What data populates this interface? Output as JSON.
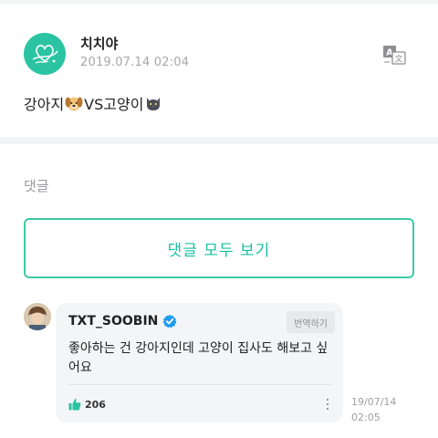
{
  "post": {
    "author": "치치야",
    "date": "2019.07.14 02:04",
    "text_part1": "강아지",
    "text_part2": "VS고양이",
    "emoji_1": "dog-face-icon",
    "emoji_2": "cat-face-icon",
    "translate_icon": "translate-icon"
  },
  "comments": {
    "label": "댓글",
    "view_all_label": "댓글 모두 보기",
    "items": [
      {
        "author": "TXT_SOOBIN",
        "verified": true,
        "translate_label": "번역하기",
        "text": "좋아하는 건 강아지인데 고양이 집사도 해보고 싶어요",
        "likes": "206",
        "time_line1": "19/07/14",
        "time_line2": "02:05"
      }
    ]
  },
  "colors": {
    "accent": "#3ec9a7",
    "accent_text": "#19c0a0",
    "verified": "#1f9cf0",
    "like": "#2bc4a3",
    "avatar_bg": "#2bc4a3"
  }
}
